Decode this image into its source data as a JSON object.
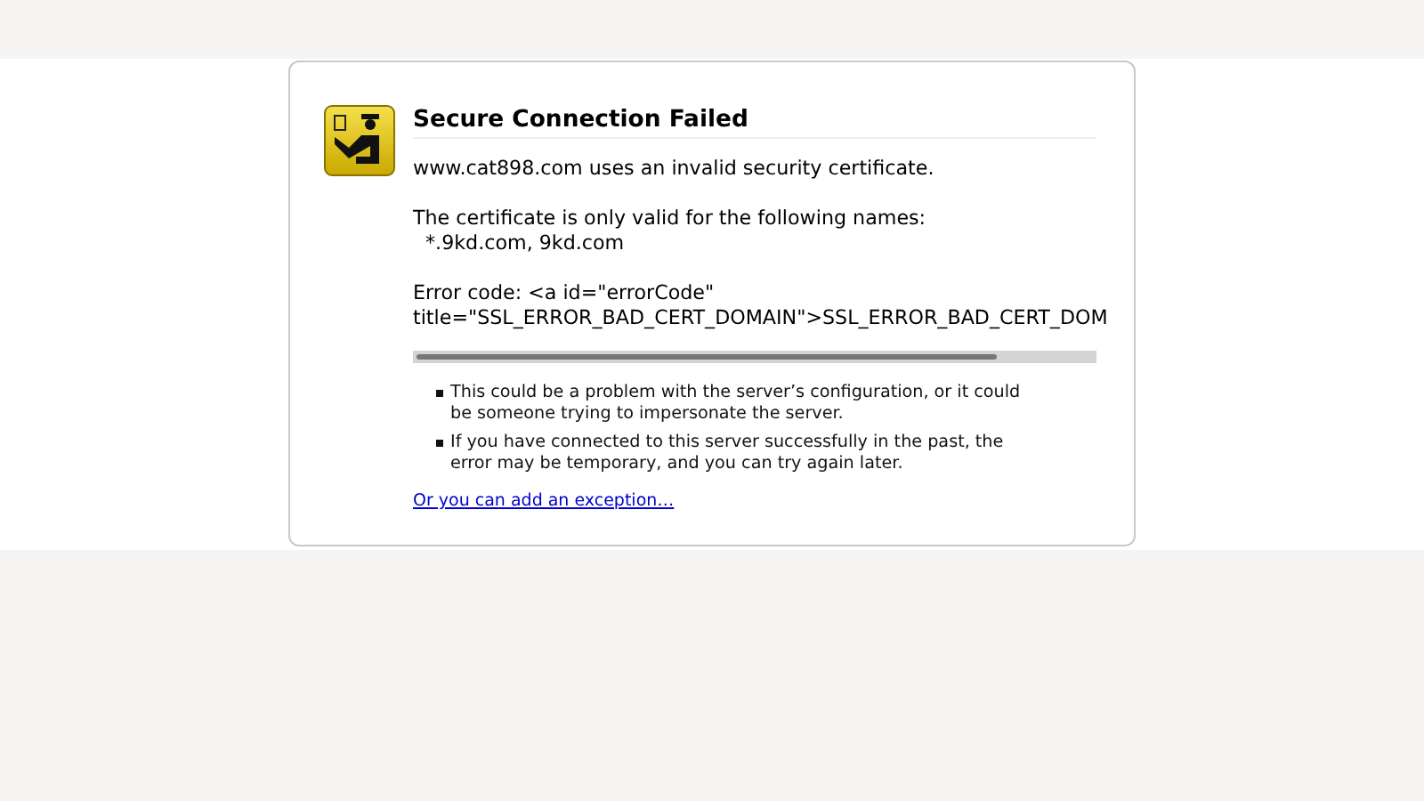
{
  "error_page": {
    "title": "Secure Connection Failed",
    "paragraphs": [
      "www.cat898.com uses an invalid security certificate."
    ],
    "names_intro": "The certificate is only valid for the following names:",
    "names": "*.9kd.com, 9kd.com",
    "error_code_lines": [
      "Error code: <a id=\"errorCode\"",
      "title=\"SSL_ERROR_BAD_CERT_DOMAIN\">SSL_ERROR_BAD_CERT_DOM"
    ],
    "bullets": [
      "This could be a problem with the server’s configuration, or it could be someone trying to impersonate the server.",
      "If you have connected to this server successfully in the past, the error may be temporary, and you can try again later."
    ],
    "link": "Or you can add an exception…"
  }
}
